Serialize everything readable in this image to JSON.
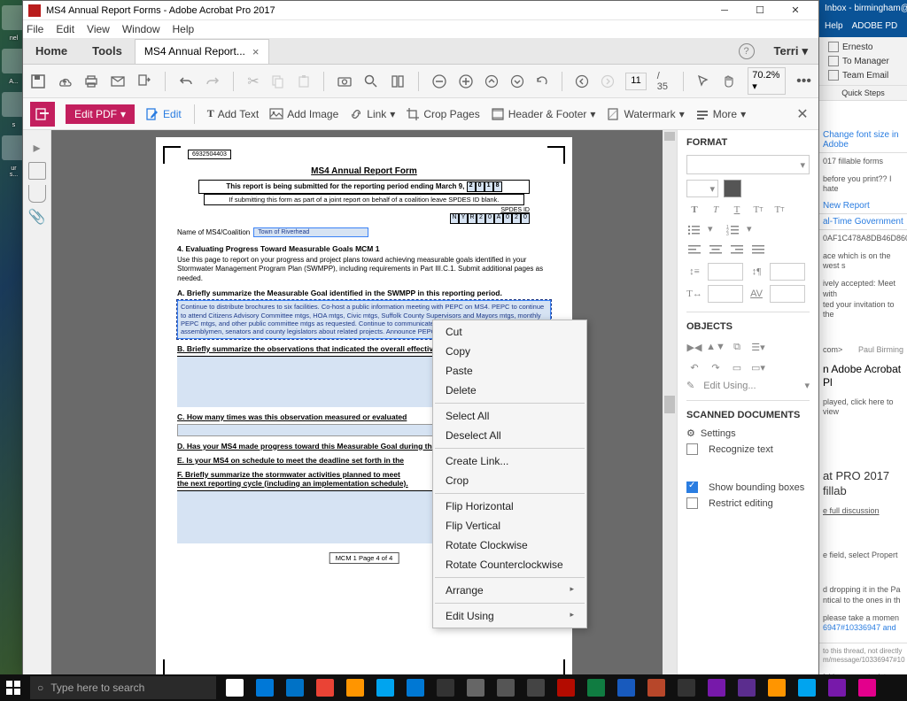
{
  "acrobat": {
    "title": "MS4 Annual Report Forms - Adobe Acrobat Pro 2017",
    "menus": [
      "File",
      "Edit",
      "View",
      "Window",
      "Help"
    ],
    "home_tab": "Home",
    "tools_tab": "Tools",
    "doc_tab": "MS4 Annual Report...",
    "user": "Terri",
    "page_current": "11",
    "page_total": "/ 35",
    "zoom": "70.2%",
    "editbar": {
      "editpdf": "Edit PDF",
      "edit": "Edit",
      "addtext": "Add Text",
      "addimage": "Add Image",
      "link": "Link",
      "crop": "Crop Pages",
      "header": "Header & Footer",
      "watermark": "Watermark",
      "more": "More"
    }
  },
  "doc": {
    "code": "6932504403",
    "title": "MS4 Annual Report Form",
    "line1": "This report is being submitted for the reporting period ending March 9,",
    "year_digits": [
      "2",
      "0",
      "1",
      "8"
    ],
    "line2": "If submitting this form as part of a joint report on behalf of a coalition leave SPDES ID blank.",
    "spdes_label": "SPDES ID",
    "spdes_digits": [
      "N",
      "Y",
      "R",
      "2",
      "0",
      "A",
      "0",
      "2",
      "0"
    ],
    "ms4_label": "Name of MS4/Coalition",
    "ms4_value": "Town of Riverhead",
    "sec4": "4.  Evaluating Progress Toward Measurable Goals MCM 1",
    "para4": "Use this page to report on your progress and project plans toward achieving measurable goals identified in your Stormwater Management Program Plan (SWMPP), including requirements in Part III.C.1. Submit additional pages as needed.",
    "secA": "A.  Briefly summarize the Measurable Goal identified in the SWMPP in this reporting period.",
    "boxA": "Continue to distribute brochures to six facilities.  Co-host a public information meeting with PEPC on MS4. PEPC to continue to attend Citizens Advisory Committee mtgs, HOA mtgs, Civic mtgs, Suffolk County Supervisors and Mayors mtgs, monthly PEPC mtgs, and other public committee mtgs as requested. Continue to communicate with regional congressmen, assemblymen, senators and county legislators about related projects.  Announce PEPC milestones with press coverage.",
    "secB": "B.  Briefly summarize the observations that indicated the overall effectiveness of this Measurable Goal.",
    "secC": "C.  How many times was this observation measured or evaluated",
    "secD": "D.  Has your MS4 made progress toward this Measurable Goal during this reporting period?",
    "secE": "E.  Is your MS4 on schedule to meet the deadline set forth in the",
    "secF": "F.  Briefly summarize the stormwater activities planned to meet",
    "secF2": "the next reporting cycle (including an implementation schedule).",
    "footer": "MCM 1 Page 4 of 4"
  },
  "ctx": {
    "cut": "Cut",
    "copy": "Copy",
    "paste": "Paste",
    "delete": "Delete",
    "selectall": "Select All",
    "deselectall": "Deselect All",
    "createlink": "Create Link...",
    "crop": "Crop",
    "fliph": "Flip Horizontal",
    "flipv": "Flip Vertical",
    "rotcw": "Rotate Clockwise",
    "rotccw": "Rotate Counterclockwise",
    "arrange": "Arrange",
    "editusing": "Edit Using"
  },
  "rp": {
    "format": "FORMAT",
    "objects": "OBJECTS",
    "editusing": "Edit Using...",
    "scanned": "SCANNED DOCUMENTS",
    "settings": "Settings",
    "recognize": "Recognize text",
    "showbb": "Show bounding boxes",
    "restrict": "Restrict editing"
  },
  "outlook": {
    "title": "Inbox - birmingham@to",
    "menu_help": "Help",
    "menu_adobe": "ADOBE PD",
    "item_ernesto": "Ernesto",
    "item_tomgr": "To Manager",
    "item_team": "Team Email",
    "quicksteps": "Quick Steps",
    "thread1": "Change font size in Adobe",
    "thread1b": "017 fillable forms",
    "snip1": "before you print??  I hate",
    "thread2": "New Report",
    "thread3": "al-Time Government",
    "thread3b": "0AF1C478A8DB46D860CCC",
    "snip2": "ace which is on the west s",
    "snip3": "ively accepted: Meet with",
    "snip3b": "ted your invitation to the",
    "from": "com>",
    "fromname": "Paul Birming",
    "subject": "n Adobe Acrobat Pl",
    "played": "played, click here to view",
    "title2": "at PRO 2017 fillab",
    "fulldisc": "e full discussion",
    "snip4": "e field, select Propert",
    "snip5": "d dropping it in the Pa",
    "snip5b": "ntical to the ones in th",
    "snip6": "please take a momen",
    "snip6b": "6947#10336947 and",
    "snip7": "to this thread, not directly",
    "snip7b": "m/message/10336947#10",
    "snip8": "folders are up to date."
  },
  "taskbar": {
    "search": "Type here to search",
    "icon_colors": [
      "#ffffff",
      "#0078d7",
      "#0072c6",
      "#ea4335",
      "#ff9500",
      "#00a4ef",
      "#0078d4",
      "#333333",
      "#666666",
      "#555555",
      "#444444",
      "#b30b00",
      "#107c41",
      "#185abd",
      "#b7472a",
      "#333333",
      "#7719aa",
      "#5b2d8e",
      "#ff9500",
      "#00a4ef",
      "#7719aa",
      "#e3008c"
    ]
  }
}
